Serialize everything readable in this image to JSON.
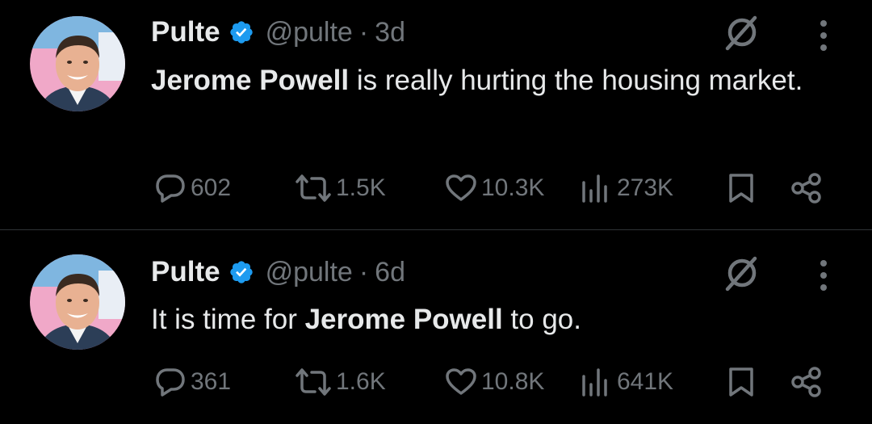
{
  "colors": {
    "background": "#000000",
    "text": "#e7e9ea",
    "muted": "#71767b",
    "verified": "#1d9bf0",
    "divider": "#2f3336"
  },
  "tweets": [
    {
      "name": "Pulte",
      "handle": "@pulte",
      "separator": "·",
      "time": "3d",
      "text_parts": [
        {
          "text": "Jerome Powell",
          "bold": true
        },
        {
          "text": " is really hurting the housing market.",
          "bold": false
        }
      ],
      "replies": "602",
      "reposts": "1.5K",
      "likes": "10.3K",
      "views": "273K",
      "icons": [
        "verified-badge-icon",
        "grok-icon",
        "more-icon",
        "reply-icon",
        "repost-icon",
        "like-icon",
        "views-icon",
        "bookmark-icon",
        "share-icon"
      ]
    },
    {
      "name": "Pulte",
      "handle": "@pulte",
      "separator": "·",
      "time": "6d",
      "text_parts": [
        {
          "text": "It is time for ",
          "bold": false
        },
        {
          "text": "Jerome Powell",
          "bold": true
        },
        {
          "text": " to go.",
          "bold": false
        }
      ],
      "replies": "361",
      "reposts": "1.6K",
      "likes": "10.8K",
      "views": "641K",
      "icons": [
        "verified-badge-icon",
        "grok-icon",
        "more-icon",
        "reply-icon",
        "repost-icon",
        "like-icon",
        "views-icon",
        "bookmark-icon",
        "share-icon"
      ]
    }
  ]
}
